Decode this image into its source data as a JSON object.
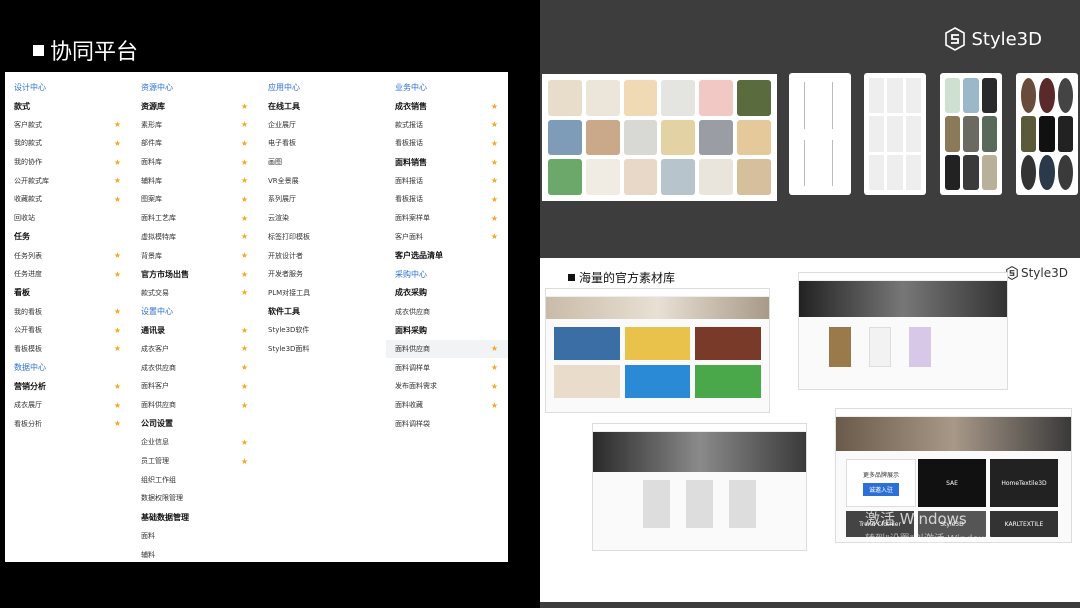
{
  "title": "协同平台",
  "brand": "Style3D",
  "panel_title": "海量的官方素材库",
  "watermark": "激活 Windows",
  "watermark_sub": "转到\"设置\"以激活 Windows。",
  "tiles": {
    "t1": "更多品牌展示",
    "t2": "诚邀入驻",
    "t3": "SAE",
    "t4": "HomeTextile3D",
    "t5": "Trend Clothier",
    "t6": "Style3D",
    "t7": "KARLTEXTILE"
  },
  "menu": {
    "col1": [
      {
        "label": "设计中心",
        "kind": "sec",
        "star": false
      },
      {
        "label": "款式",
        "kind": "b",
        "star": false
      },
      {
        "label": "客户款式",
        "kind": "n",
        "star": true
      },
      {
        "label": "我的款式",
        "kind": "n",
        "star": true
      },
      {
        "label": "我的协作",
        "kind": "n",
        "star": true
      },
      {
        "label": "公开款式库",
        "kind": "n",
        "star": true
      },
      {
        "label": "收藏款式",
        "kind": "n",
        "star": true
      },
      {
        "label": "回收站",
        "kind": "n",
        "star": false
      },
      {
        "label": "任务",
        "kind": "b",
        "star": false
      },
      {
        "label": "任务列表",
        "kind": "n",
        "star": true
      },
      {
        "label": "任务进度",
        "kind": "n",
        "star": true
      },
      {
        "label": "看板",
        "kind": "b",
        "star": false
      },
      {
        "label": "我的看板",
        "kind": "n",
        "star": true
      },
      {
        "label": "公开看板",
        "kind": "n",
        "star": true
      },
      {
        "label": "看板模板",
        "kind": "n",
        "star": true
      },
      {
        "label": "数据中心",
        "kind": "sec",
        "star": false
      },
      {
        "label": "营销分析",
        "kind": "b",
        "star": true
      },
      {
        "label": "成衣展厅",
        "kind": "n",
        "star": true
      },
      {
        "label": "看板分析",
        "kind": "n",
        "star": true
      }
    ],
    "col2": [
      {
        "label": "资源中心",
        "kind": "sec",
        "star": false
      },
      {
        "label": "资源库",
        "kind": "b",
        "star": true
      },
      {
        "label": "素形库",
        "kind": "n",
        "star": true
      },
      {
        "label": "部件库",
        "kind": "n",
        "star": true
      },
      {
        "label": "面料库",
        "kind": "n",
        "star": true
      },
      {
        "label": "辅料库",
        "kind": "n",
        "star": true
      },
      {
        "label": "图案库",
        "kind": "n",
        "star": true
      },
      {
        "label": "面料工艺库",
        "kind": "n",
        "star": true
      },
      {
        "label": "虚拟模特库",
        "kind": "n",
        "star": true
      },
      {
        "label": "背景库",
        "kind": "n",
        "star": true
      },
      {
        "label": "官方市场出售",
        "kind": "b",
        "star": true
      },
      {
        "label": "款式交易",
        "kind": "n",
        "star": true
      },
      {
        "label": "设置中心",
        "kind": "sec",
        "star": false
      },
      {
        "label": "通讯录",
        "kind": "b",
        "star": true
      },
      {
        "label": "成衣客户",
        "kind": "n",
        "star": true
      },
      {
        "label": "成衣供应商",
        "kind": "n",
        "star": true
      },
      {
        "label": "面料客户",
        "kind": "n",
        "star": true
      },
      {
        "label": "面料供应商",
        "kind": "n",
        "star": true
      },
      {
        "label": "公司设置",
        "kind": "b",
        "star": false
      },
      {
        "label": "企业信息",
        "kind": "n",
        "star": true
      },
      {
        "label": "员工管理",
        "kind": "n",
        "star": true
      },
      {
        "label": "组织工作组",
        "kind": "n",
        "star": false
      },
      {
        "label": "数据权限管理",
        "kind": "n",
        "star": false
      },
      {
        "label": "基础数据管理",
        "kind": "b",
        "star": false
      },
      {
        "label": "面料",
        "kind": "n",
        "star": false
      },
      {
        "label": "辅料",
        "kind": "n",
        "star": false
      }
    ],
    "col3": [
      {
        "label": "应用中心",
        "kind": "sec",
        "star": false
      },
      {
        "label": "在线工具",
        "kind": "b",
        "star": false
      },
      {
        "label": "企业展厅",
        "kind": "n",
        "star": false
      },
      {
        "label": "电子看板",
        "kind": "n",
        "star": false
      },
      {
        "label": "画图",
        "kind": "n",
        "star": false
      },
      {
        "label": "VR全景展",
        "kind": "n",
        "star": false
      },
      {
        "label": "系列展厅",
        "kind": "n",
        "star": false
      },
      {
        "label": "云渲染",
        "kind": "n",
        "star": false
      },
      {
        "label": "标签打印模板",
        "kind": "n",
        "star": false
      },
      {
        "label": "开放设计者",
        "kind": "n",
        "star": false
      },
      {
        "label": "开发者服务",
        "kind": "n",
        "star": false
      },
      {
        "label": "PLM对接工具",
        "kind": "n",
        "star": false
      },
      {
        "label": "软件工具",
        "kind": "b",
        "star": false
      },
      {
        "label": "Style3D软件",
        "kind": "n",
        "star": false
      },
      {
        "label": "Style3D面料",
        "kind": "n",
        "star": false
      }
    ],
    "col4": [
      {
        "label": "业务中心",
        "kind": "sec",
        "star": false
      },
      {
        "label": "成衣销售",
        "kind": "b",
        "star": true
      },
      {
        "label": "款式报话",
        "kind": "n",
        "star": true
      },
      {
        "label": "看板报话",
        "kind": "n",
        "star": true
      },
      {
        "label": "面料销售",
        "kind": "b",
        "star": true
      },
      {
        "label": "面料报话",
        "kind": "n",
        "star": true
      },
      {
        "label": "看板报话",
        "kind": "n",
        "star": true
      },
      {
        "label": "面料案样单",
        "kind": "n",
        "star": true
      },
      {
        "label": "客户面料",
        "kind": "n",
        "star": true
      },
      {
        "label": "客户选品清单",
        "kind": "b",
        "star": false
      },
      {
        "label": "采购中心",
        "kind": "sec",
        "star": false
      },
      {
        "label": "成衣采购",
        "kind": "b",
        "star": false
      },
      {
        "label": "成衣供应商",
        "kind": "n",
        "star": false
      },
      {
        "label": "面料采购",
        "kind": "b",
        "star": false
      },
      {
        "label": "面料供应商",
        "kind": "hl",
        "star": true
      },
      {
        "label": "面料调样单",
        "kind": "n",
        "star": true
      },
      {
        "label": "发布面料需求",
        "kind": "n",
        "star": true
      },
      {
        "label": "面料收藏",
        "kind": "n",
        "star": true
      },
      {
        "label": "面料调样袋",
        "kind": "n",
        "star": false
      }
    ]
  },
  "colors": {
    "accent": "#2c6fd6",
    "star": "#f5a623"
  }
}
